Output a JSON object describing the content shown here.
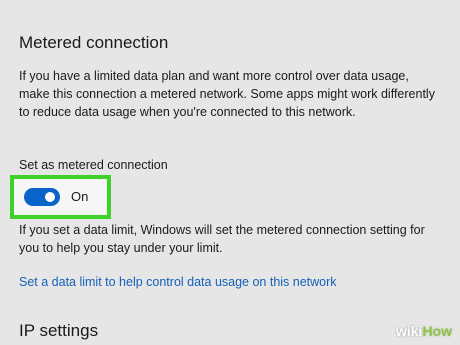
{
  "metered_section": {
    "title": "Metered connection",
    "description": "If you have a limited data plan and want more control over data usage, make this connection a metered network. Some apps might work differently to reduce data usage when you're connected to this network.",
    "toggle_label": "Set as metered connection",
    "toggle_state": "On",
    "toggle_on": true,
    "info_text": "If you set a data limit, Windows will set the metered connection setting for you to help you stay under your limit.",
    "link_text": "Set a data limit to help control data usage on this network"
  },
  "ip_section": {
    "title": "IP settings"
  },
  "watermark": {
    "part1": "wiki",
    "part2": "How"
  },
  "colors": {
    "toggle_on": "#0a63c9",
    "highlight": "#3ed12a",
    "link": "#1560b8",
    "background": "#e6e6e6"
  }
}
